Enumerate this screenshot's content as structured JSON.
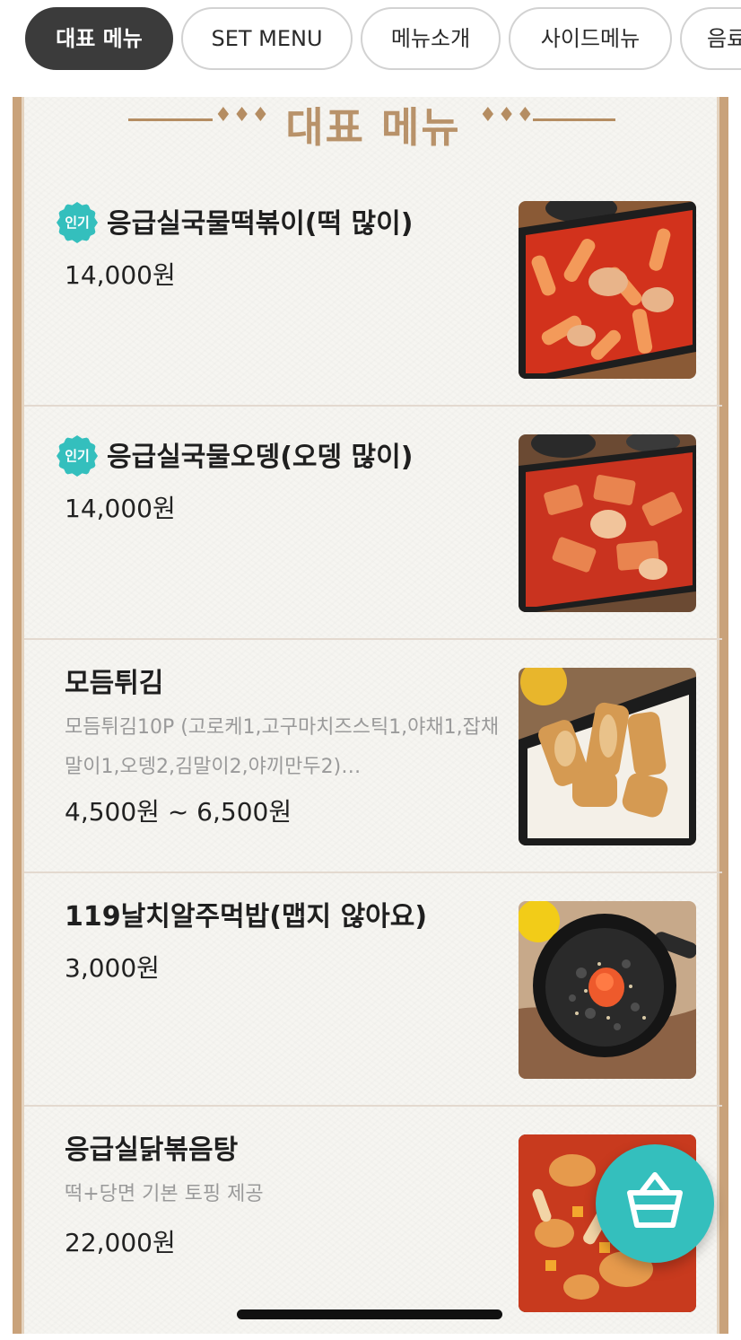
{
  "tabs": [
    {
      "label": "대표 메뉴",
      "active": true
    },
    {
      "label": "SET MENU",
      "active": false
    },
    {
      "label": "메뉴소개",
      "active": false
    },
    {
      "label": "사이드메뉴",
      "active": false
    },
    {
      "label": "음료",
      "active": false
    }
  ],
  "section": {
    "title": "대표 메뉴",
    "ornament": "♦♦♦"
  },
  "popular_badge": "인기",
  "items": [
    {
      "name": "응급실국물떡볶이(떡 많이)",
      "price": "14,000원",
      "popular": true,
      "photo_icon": "tteokbokki-photo"
    },
    {
      "name": "응급실국물오뎅(오뎅 많이)",
      "price": "14,000원",
      "popular": true,
      "photo_icon": "fishcake-stew-photo"
    },
    {
      "name": "모듬튀김",
      "desc": "모듬튀김10P (고로케1,고구마치즈스틱1,야채1,잡채말이1,오뎅2,김말이2,야끼만두2)…",
      "price": "4,500원 ~ 6,500원",
      "popular": false,
      "photo_icon": "fried-snacks-photo"
    },
    {
      "name": "119날치알주먹밥(맵지 않아요)",
      "price": "3,000원",
      "popular": false,
      "photo_icon": "rice-ball-bowl-photo"
    },
    {
      "name": "응급실닭볶음탕",
      "desc": "떡+당면 기본 토핑 제공",
      "price": "22,000원",
      "popular": false,
      "photo_icon": "chicken-stew-photo"
    }
  ],
  "cart": {
    "icon": "basket-icon"
  },
  "colors": {
    "accent": "#34bfbd",
    "tab_active": "#3b3b3b",
    "gold": "#b8926a",
    "frame": "#c9a27a"
  }
}
